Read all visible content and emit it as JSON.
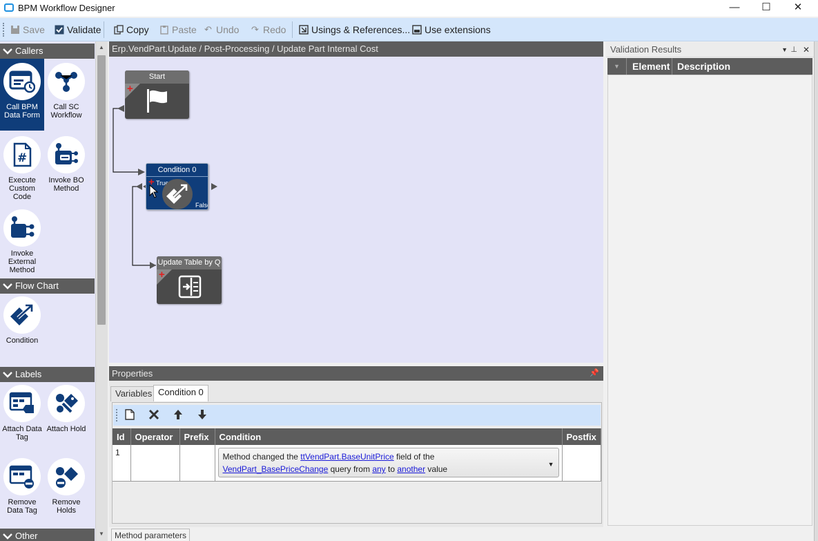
{
  "window": {
    "title": "BPM Workflow Designer",
    "minimize_glyph": "—",
    "maximize_glyph": "☐",
    "close_glyph": "✕"
  },
  "toolbar": {
    "save": "Save",
    "validate": "Validate",
    "copy": "Copy",
    "paste": "Paste",
    "undo": "Undo",
    "redo": "Redo",
    "usings": "Usings & References...",
    "extensions": "Use extensions"
  },
  "palette": {
    "callers": {
      "title": "Callers",
      "items": [
        {
          "label": "Call BPM Data Form",
          "icon": "data-form-icon"
        },
        {
          "label": "Call SC Workflow",
          "icon": "workflow-icon"
        },
        {
          "label": "Execute Custom Code",
          "icon": "custom-code-icon"
        },
        {
          "label": "Invoke BO Method",
          "icon": "bo-method-icon"
        },
        {
          "label": "Invoke External Method",
          "icon": "external-method-icon"
        }
      ]
    },
    "flowchart": {
      "title": "Flow Chart",
      "items": [
        {
          "label": "Condition",
          "icon": "condition-icon"
        }
      ]
    },
    "labels": {
      "title": "Labels",
      "items": [
        {
          "label": "Attach Data Tag",
          "icon": "data-tag-icon"
        },
        {
          "label": "Attach Hold",
          "icon": "hold-icon"
        },
        {
          "label": "Remove Data Tag",
          "icon": "remove-data-tag-icon"
        },
        {
          "label": "Remove Holds",
          "icon": "remove-holds-icon"
        }
      ]
    },
    "other": {
      "title": "Other"
    }
  },
  "canvas": {
    "breadcrumb": "Erp.VendPart.Update / Post-Processing / Update Part Internal Cost",
    "nodes": {
      "start": {
        "title": "Start"
      },
      "condition": {
        "title": "Condition 0",
        "true_label": "True",
        "false_label": "False"
      },
      "update": {
        "title": "Update Table by Q"
      }
    }
  },
  "properties": {
    "title": "Properties",
    "tabs": {
      "variables": "Variables",
      "condition": "Condition 0"
    },
    "columns": {
      "id": "Id",
      "operator": "Operator",
      "prefix": "Prefix",
      "condition": "Condition",
      "postfix": "Postfix"
    },
    "row": {
      "id": "1",
      "operator": "",
      "prefix": "",
      "cond_t1": "Method changed the ",
      "cond_link1": "ttVendPart.BaseUnitPrice",
      "cond_t2": " field of the",
      "cond_link2": "VendPart_BasePriceChange",
      "cond_t3": " query from ",
      "cond_link3": "any",
      "cond_t4": " to ",
      "cond_link4": "another",
      "cond_t5": " value",
      "postfix": ""
    },
    "bottom_tab": "Method parameters"
  },
  "validation": {
    "title": "Validation Results",
    "columns": {
      "element": "Element",
      "description": "Description"
    }
  }
}
